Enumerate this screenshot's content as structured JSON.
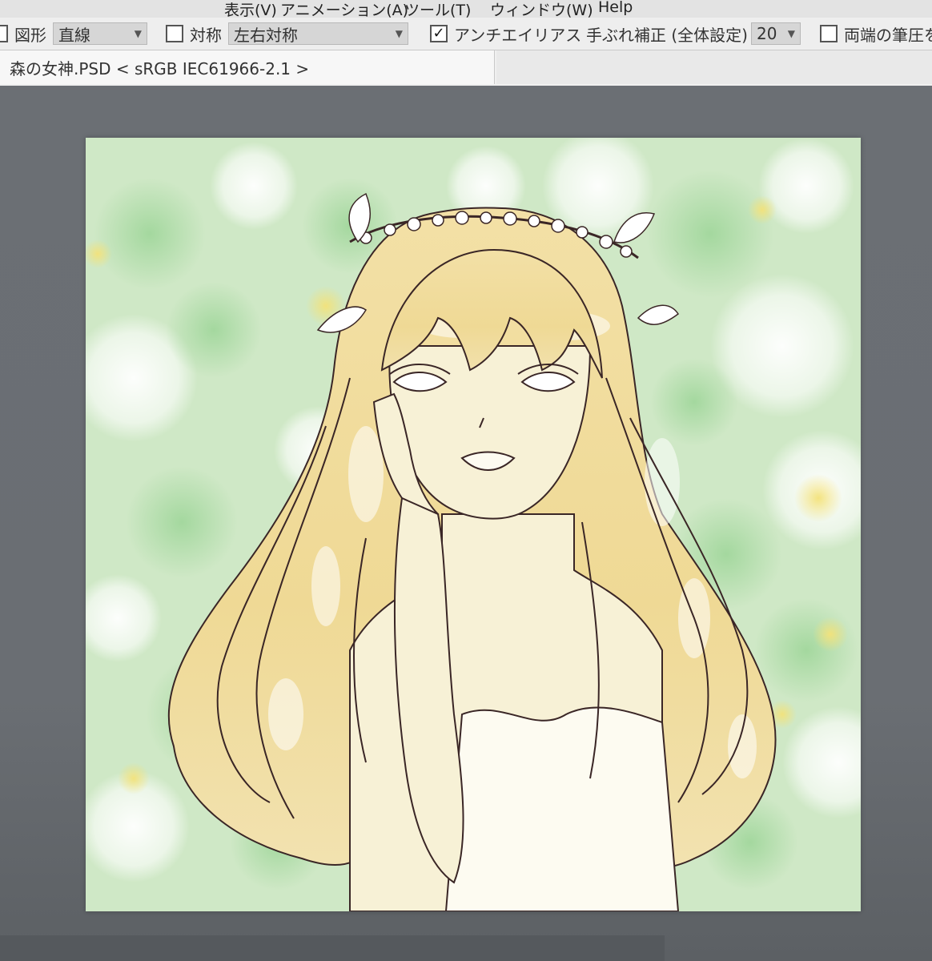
{
  "menu": {
    "items": [
      "表示(V)",
      "アニメーション(A)",
      "ツール(T)",
      "ウィンドウ(W)",
      "Help"
    ]
  },
  "toolbar": {
    "figure_label": "図形",
    "figure_value": "直線",
    "symmetry_label": "対称",
    "symmetry_value": "左右対称",
    "antialias_label": "アンチエイリアス",
    "antialias_checked": "✓",
    "stabilizer_label": "手ぶれ補正 (全体設定)",
    "stabilizer_value": "20",
    "pressure_label": "両端の筆圧を"
  },
  "document": {
    "tab_title": "森の女神.PSD < sRGB IEC61966-2.1 >"
  },
  "colors": {
    "canvas_green": "#cfe8c6",
    "hair_yellow": "#f0dca0",
    "line_art": "#3a2626",
    "workspace_gray": "#6d7176"
  },
  "icons": {
    "checkbox": "checkbox-icon",
    "dropdown": "chevron-down-icon",
    "cursor": "pen-cursor-icon"
  }
}
